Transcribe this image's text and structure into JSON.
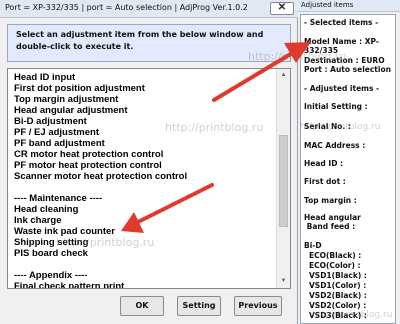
{
  "window": {
    "title": "Port = XP-332/335 | port = Auto selection | AdjProg Ver.1.0.2",
    "close_glyph": "✕"
  },
  "instruction": "Select an adjustment item from the below window and double-click to execute it.",
  "list": {
    "items": [
      "Head ID input",
      "First dot position adjustment",
      "Top margin adjustment",
      "Head angular adjustment",
      "Bi-D adjustment",
      "PF / EJ adjustment",
      "PF band adjustment",
      "CR motor heat protection control",
      "PF motor heat protection control",
      "Scanner motor heat protection control",
      "",
      "---- Maintenance ----",
      "Head cleaning",
      "Ink charge",
      "Waste ink pad counter",
      "Shipping setting",
      "PIS board check",
      "",
      "---- Appendix ----",
      "Final check pattern print"
    ]
  },
  "buttons": {
    "ok": "OK",
    "setting": "Setting",
    "previous": "Previous"
  },
  "adjusted_panel": {
    "title": "Adjusted items",
    "selected_header": "- Selected items -",
    "model_line1": "Model Name : XP-",
    "model_line2": "332/335",
    "destination": "Destination : EURO",
    "port": "Port : Auto selection",
    "adjusted_header": "- Adjusted items -",
    "fields": [
      "Initial Setting :",
      "Serial No. :",
      "MAC Address :",
      "Head ID :",
      "First dot :",
      "Top margin :",
      "Head angular",
      " Band feed :"
    ],
    "bid_label": "Bi-D",
    "bid_rows": [
      "ECO(Black) :",
      "ECO(Color) :",
      "VSD1(Black) :",
      "VSD1(Color) :",
      "VSD2(Black) :",
      "VSD2(Color) :",
      "VSD3(Black) :"
    ]
  },
  "watermark": "http://printblog.ru",
  "colors": {
    "arrow": "#e03a2c",
    "instruction_bg": "#e3e9ff",
    "titlebar": "#dfe8f3"
  }
}
